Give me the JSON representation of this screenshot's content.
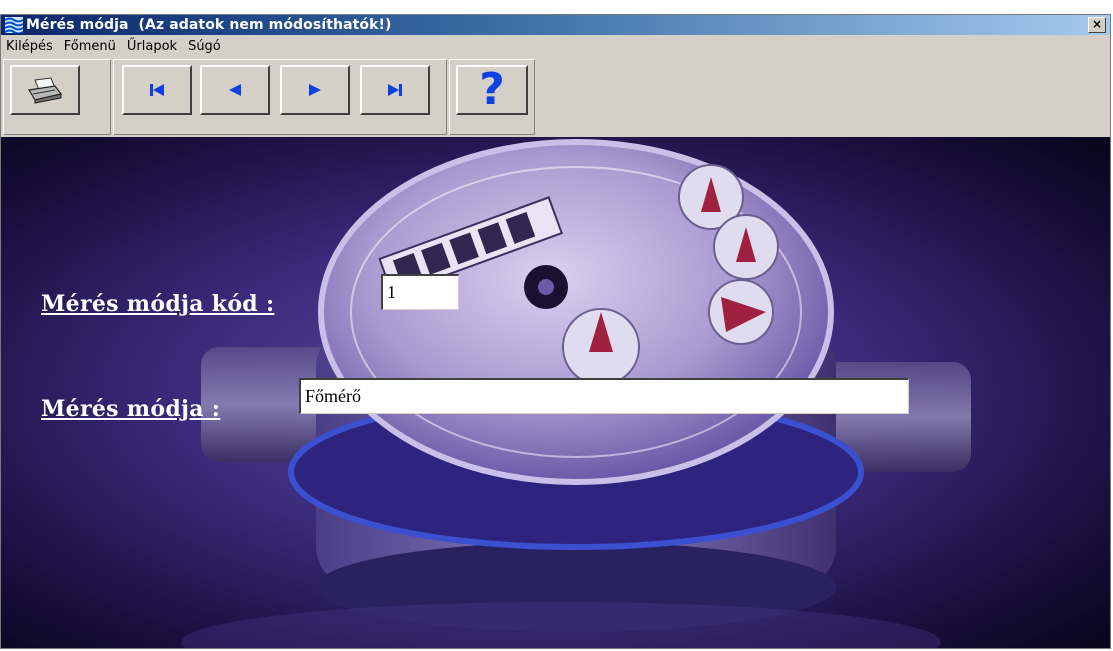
{
  "window": {
    "title": "Mérés módja  (Az adatok nem módosíthatók!)",
    "close_label": "×"
  },
  "menu": {
    "items": [
      "Kilépés",
      "Főmenü",
      "Űrlapok",
      "Súgó"
    ]
  },
  "toolbar": {
    "buttons": [
      {
        "icon": "printer-icon"
      },
      {
        "icon": "first-record-icon"
      },
      {
        "icon": "previous-record-icon"
      },
      {
        "icon": "next-record-icon"
      },
      {
        "icon": "last-record-icon"
      },
      {
        "icon": "help-icon",
        "glyph": "?"
      }
    ]
  },
  "form": {
    "code_label": "Mérés módja kód :",
    "code_value": "1",
    "name_label": "Mérés módja :",
    "name_value": "Főmérő"
  },
  "colors": {
    "title_start": "#0a246a",
    "title_end": "#a6caf0",
    "nav_blue": "#1040e0",
    "background_purple": "#3a2a7a"
  }
}
